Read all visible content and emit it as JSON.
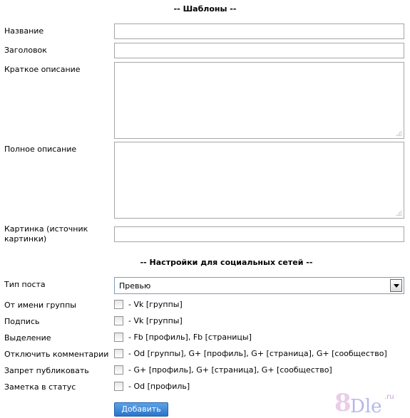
{
  "sections": {
    "templates_title": "-- Шаблоны --",
    "social_title": "-- Настройки для социальных сетей --"
  },
  "fields": {
    "name": {
      "label": "Название",
      "value": ""
    },
    "heading": {
      "label": "Заголовок",
      "value": ""
    },
    "short_desc": {
      "label": "Краткое описание",
      "value": ""
    },
    "full_desc": {
      "label": "Полное описание",
      "value": ""
    },
    "image": {
      "label": "Картинка (источник картинки)",
      "value": ""
    }
  },
  "post_type": {
    "label": "Тип поста",
    "selected": "Превью"
  },
  "options": [
    {
      "label": "От имени группы",
      "desc": "- Vk [группы]",
      "checked": false
    },
    {
      "label": "Подпись",
      "desc": "- Vk [группы]",
      "checked": false
    },
    {
      "label": "Выделение",
      "desc": "- Fb [профиль], Fb [страницы]",
      "checked": false
    },
    {
      "label": "Отключить комментарии",
      "desc": "- Od [группы], G+ [профиль], G+ [страница], G+ [сообщество]",
      "checked": false
    },
    {
      "label": "Запрет публиковать",
      "desc": "- G+ [профиль], G+ [страница], G+ [сообщество]",
      "checked": false
    },
    {
      "label": "Заметка в статус",
      "desc": "- Od [профиль]",
      "checked": false
    }
  ],
  "actions": {
    "submit_label": "Добавить"
  },
  "watermark": {
    "number": "8",
    "text": "Dle",
    "suffix": ".ru"
  },
  "colors": {
    "button": "#2a74c9",
    "border": "#a6a6a6"
  }
}
